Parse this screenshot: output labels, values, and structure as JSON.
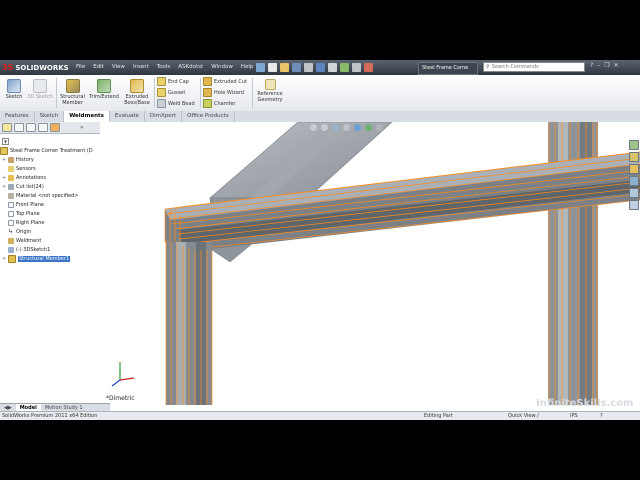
{
  "app": {
    "brand": "SOLIDWORKS",
    "brand_prefix": "3S",
    "menu": [
      "File",
      "Edit",
      "View",
      "Insert",
      "Tools",
      "ASKdotst",
      "Window",
      "Help"
    ],
    "document_title": "Steel Frame Corne",
    "search_placeholder": "Search Commands"
  },
  "ribbon": {
    "tools_large": [
      {
        "label": "Sketch",
        "icon": "sketch-icon",
        "enabled": true
      },
      {
        "label": "3D Sketch",
        "icon": "3d-sketch-icon",
        "enabled": false
      },
      {
        "label": "Structural Member",
        "icon": "structural-member-icon",
        "enabled": true
      },
      {
        "label": "Trim/Extend",
        "icon": "trim-extend-icon",
        "enabled": true
      },
      {
        "label": "Extruded Boss/Base",
        "icon": "extruded-boss-icon",
        "enabled": true
      }
    ],
    "tools_small_col1": [
      {
        "label": "End Cap",
        "icon": "end-cap-icon"
      },
      {
        "label": "Gusset",
        "icon": "gusset-icon"
      },
      {
        "label": "Weld Bead",
        "icon": "weld-bead-icon"
      }
    ],
    "tools_small_col2": [
      {
        "label": "Extruded Cut",
        "icon": "extruded-cut-icon"
      },
      {
        "label": "Hole Wizard",
        "icon": "hole-wizard-icon"
      },
      {
        "label": "Chamfer",
        "icon": "chamfer-icon"
      }
    ],
    "reference_geometry": "Reference Geometry"
  },
  "tabs": [
    "Features",
    "Sketch",
    "Weldments",
    "Evaluate",
    "DimXpert",
    "Office Products"
  ],
  "active_tab": "Weldments",
  "tree": {
    "root": "Steel Frame Corner Treatment (D",
    "items": [
      {
        "label": "History",
        "expander": "+"
      },
      {
        "label": "Sensors",
        "expander": ""
      },
      {
        "label": "Annotations",
        "expander": "+"
      },
      {
        "label": "Cut list(24)",
        "expander": "+"
      },
      {
        "label": "Material <not specified>",
        "expander": ""
      },
      {
        "label": "Front Plane",
        "expander": ""
      },
      {
        "label": "Top Plane",
        "expander": ""
      },
      {
        "label": "Right Plane",
        "expander": ""
      },
      {
        "label": "Origin",
        "expander": ""
      },
      {
        "label": "Weldment",
        "expander": ""
      },
      {
        "label": "(-) 3DSketch1",
        "expander": ""
      },
      {
        "label": "Structural Member1",
        "expander": "+"
      }
    ]
  },
  "viewport": {
    "view_orientation": "*Dimetric"
  },
  "bottom_tabs": [
    "Model",
    "Motion Study 1"
  ],
  "active_bottom_tab": "Model",
  "status": {
    "product": "SolidWorks Premium 2011 x64 Edition",
    "mode": "Editing Part",
    "quick_view": "Quick View /",
    "units": "IPS",
    "help": "?"
  },
  "watermark": "InfiniteSkills.com",
  "colors": {
    "selection_highlight": "#ff8c1a",
    "beam_gray": "#8f959c",
    "panel_selection": "#3b74c9"
  }
}
